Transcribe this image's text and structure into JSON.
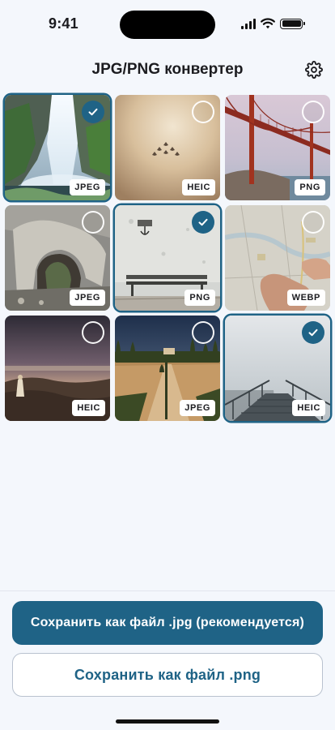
{
  "status_bar": {
    "time": "9:41",
    "battery_level": 1.0
  },
  "header": {
    "title": "JPG/PNG конвертер",
    "settings_icon": "gear-icon"
  },
  "photos": [
    {
      "scene": "waterfall",
      "format": "JPEG",
      "selected": true
    },
    {
      "scene": "sky-jets",
      "format": "HEIC",
      "selected": false
    },
    {
      "scene": "bridge",
      "format": "PNG",
      "selected": false
    },
    {
      "scene": "rock-arch",
      "format": "JPEG",
      "selected": false
    },
    {
      "scene": "wall-bench",
      "format": "PNG",
      "selected": true
    },
    {
      "scene": "map-hand",
      "format": "WEBP",
      "selected": false
    },
    {
      "scene": "cliff-sunset",
      "format": "HEIC",
      "selected": false
    },
    {
      "scene": "cypress-road",
      "format": "JPEG",
      "selected": false
    },
    {
      "scene": "foggy-pier",
      "format": "HEIC",
      "selected": true
    }
  ],
  "actions": {
    "save_jpg_label": "Сохранить как файл .jpg (рекомендуется)",
    "save_png_label": "Сохранить как файл .png"
  },
  "colors": {
    "accent": "#1f6386",
    "background": "#f4f7fc"
  }
}
